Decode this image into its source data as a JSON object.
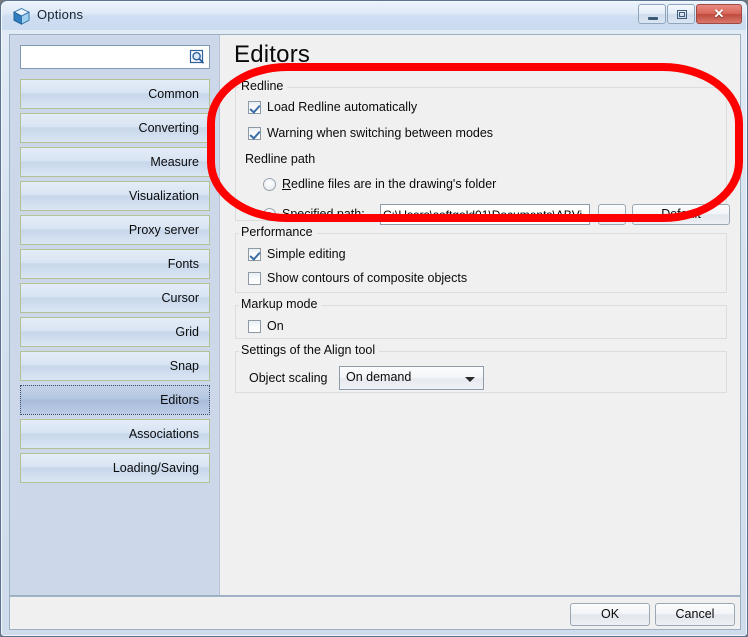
{
  "window": {
    "title": "Options",
    "icon": "cube-icon",
    "controls": {
      "minimize": "minimize-icon",
      "maximize": "maximize-icon",
      "close": "✕"
    }
  },
  "sidebar": {
    "search": {
      "value": "",
      "placeholder": "",
      "icon": "search-icon"
    },
    "items": [
      {
        "label": "Common",
        "selected": false
      },
      {
        "label": "Converting",
        "selected": false
      },
      {
        "label": "Measure",
        "selected": false
      },
      {
        "label": "Visualization",
        "selected": false
      },
      {
        "label": "Proxy server",
        "selected": false
      },
      {
        "label": "Fonts",
        "selected": false
      },
      {
        "label": "Cursor",
        "selected": false
      },
      {
        "label": "Grid",
        "selected": false
      },
      {
        "label": "Snap",
        "selected": false
      },
      {
        "label": "Editors",
        "selected": true
      },
      {
        "label": "Associations",
        "selected": false
      },
      {
        "label": "Loading/Saving",
        "selected": false
      }
    ]
  },
  "main": {
    "page_title": "Editors",
    "redline": {
      "group_label": "Redline",
      "load_automatically": {
        "label": "Load Redline automatically",
        "checked": true
      },
      "warning_switching": {
        "label": "Warning when switching between modes",
        "checked": true
      },
      "path_label": "Redline path",
      "option_drawing_folder": {
        "label_prefix": "",
        "label_accel": "R",
        "label_rest": "edline files are in the drawing's folder",
        "selected": false
      },
      "option_specified": {
        "label": "Specified path:",
        "selected": true
      },
      "path_value": "C:\\Users\\softgold01\\Documents\\ABVi",
      "browse_button": "...",
      "default_button": {
        "accel": "D",
        "rest": "efault"
      }
    },
    "performance": {
      "group_label": "Performance",
      "simple_editing": {
        "label": "Simple editing",
        "checked": true
      },
      "show_contours": {
        "label": "Show contours of composite objects",
        "checked": false
      }
    },
    "markup": {
      "group_label": "Markup mode",
      "on": {
        "label": "On",
        "checked": false
      }
    },
    "align": {
      "group_label": "Settings of the Align tool",
      "object_scaling_label": "Object scaling",
      "object_scaling_value": "On demand",
      "object_scaling_options": [
        "On demand"
      ]
    }
  },
  "footer": {
    "ok": "OK",
    "cancel": "Cancel"
  },
  "annotation": {
    "type": "red-highlight-oval",
    "color": "#fe0000"
  }
}
